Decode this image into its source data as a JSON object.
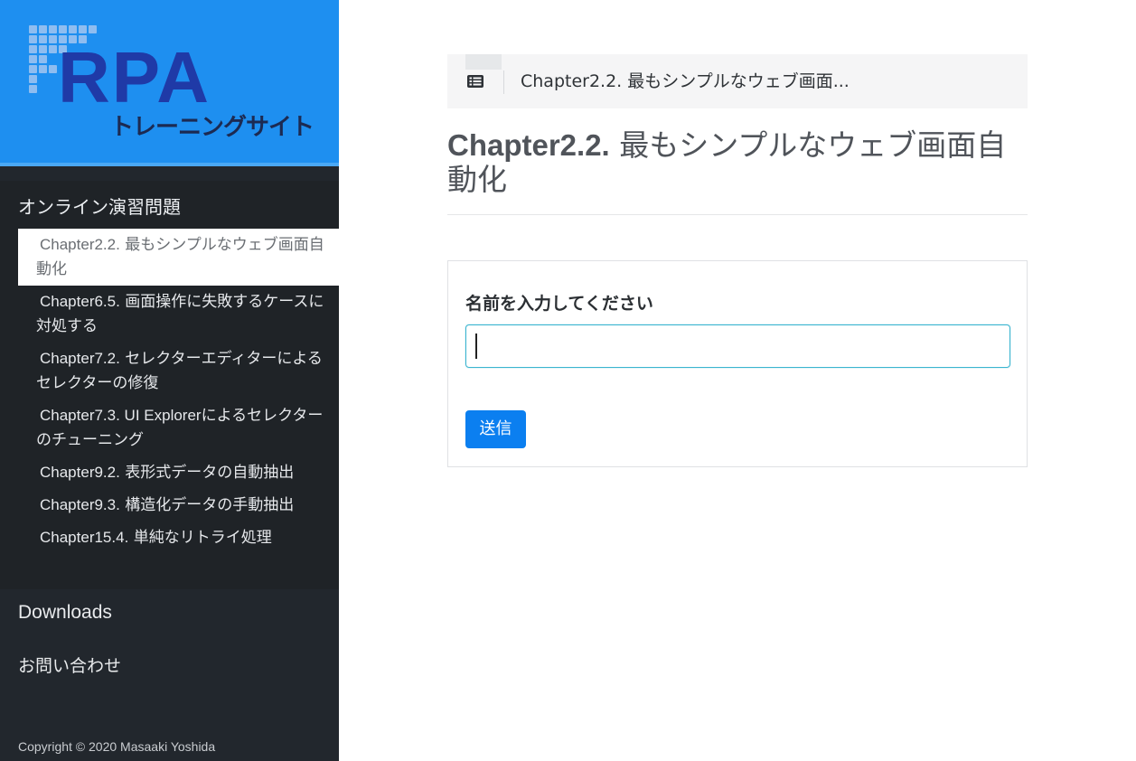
{
  "logo": {
    "title": "RPA",
    "subtitle": "トレーニングサイト",
    "colors": {
      "background": "#1e8ff0",
      "title": "#1f3aa7",
      "subtitle": "#1c2a52"
    }
  },
  "sidebar": {
    "section_title": "オンライン演習問題",
    "items": [
      {
        "prefix": "Chapter2.2.",
        "label": " 最もシンプルなウェブ画面自動化",
        "active": true
      },
      {
        "prefix": "Chapter6.5.",
        "label": " 画面操作に失敗するケースに対処する",
        "active": false
      },
      {
        "prefix": "Chapter7.2.",
        "label": " セレクターエディターによるセレクターの修復",
        "active": false
      },
      {
        "prefix": "Chapter7.3. UI Explorer",
        "label": "によるセレクターのチューニング",
        "active": false
      },
      {
        "prefix": "Chapter9.2.",
        "label": " 表形式データの自動抽出",
        "active": false
      },
      {
        "prefix": "Chapter9.3.",
        "label": " 構造化データの手動抽出",
        "active": false
      },
      {
        "prefix": "Chapter15.4.",
        "label": " 単純なリトライ処理",
        "active": false
      }
    ],
    "downloads": "Downloads",
    "contact": "お問い合わせ",
    "copyright": "Copyright © 2020 Masaaki Yoshida"
  },
  "breadcrumb": {
    "icon": "list-icon",
    "text": "Chapter2.2. 最もシンプルなウェブ画面..."
  },
  "page": {
    "title_prefix": "Chapter2.2.",
    "title_rest": " 最もシンプルなウェブ画面自動化"
  },
  "form": {
    "label": "名前を入力してください",
    "input_value": "",
    "input_placeholder": "",
    "submit_label": "送信",
    "accent": "#0b7ff0"
  }
}
